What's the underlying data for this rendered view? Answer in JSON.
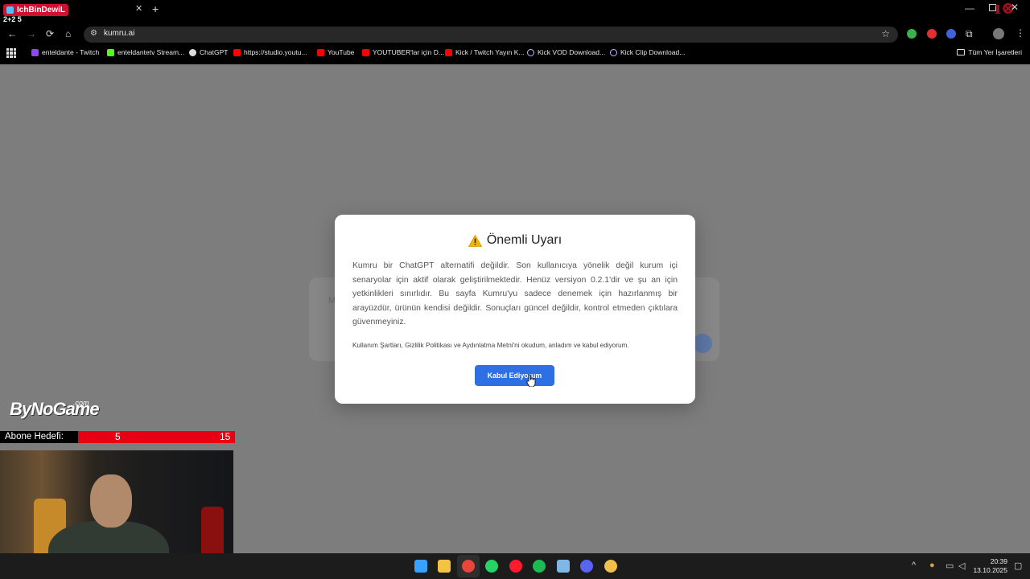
{
  "browser": {
    "tab_title": "IchBinDewiL",
    "overlay_text": "2+2 5",
    "url": "kumru.ai",
    "bookmarks": [
      {
        "label": "enteldante - Twitch",
        "icon": "twitch-icon",
        "color": "#9146ff"
      },
      {
        "label": "enteldantetv Stream...",
        "icon": "kick-icon",
        "color": "#53fc18"
      },
      {
        "label": "ChatGPT",
        "icon": "chatgpt-icon",
        "color": "#dddddd"
      },
      {
        "label": "https://studio.youtu...",
        "icon": "youtube-icon",
        "color": "#ff0000"
      },
      {
        "label": "YouTube",
        "icon": "youtube-icon",
        "color": "#ff0000"
      },
      {
        "label": "YOUTUBER'lar için D...",
        "icon": "youtube-icon",
        "color": "#ff0000"
      },
      {
        "label": "Kick / Twitch Yayın K...",
        "icon": "youtube-icon",
        "color": "#ff0000"
      },
      {
        "label": "Kick VOD Download...",
        "icon": "link-icon",
        "color": "#c9b6ff"
      },
      {
        "label": "Kick Clip Download...",
        "icon": "link-icon",
        "color": "#c9b6ff"
      }
    ],
    "all_bookmarks_label": "Tüm Yer İşaretleri"
  },
  "modal": {
    "title": "Önemli Uyarı",
    "body": "Kumru bir ChatGPT alternatifi değildir. Son kullanıcıya yönelik değil kurum içi senaryolar için aktif olarak geliştirilmektedir. Henüz versiyon 0.2.1'dir ve şu an için yetkinlikleri sınırlıdır. Bu sayfa Kumru'yu sadece denemek için hazırlanmış bir arayüzdür, ürünün kendisi değildir. Sonuçları güncel değildir, kontrol etmeden çıktılara güvenmeyiniz.",
    "terms": "Kullanım Şartları, Gizlilik Politikası ve Aydınlatma Metni'ni okudum, anladım ve kabul ediyorum.",
    "accept_label": "Kabul Ediyorum"
  },
  "background_page": {
    "placeholder": "M"
  },
  "stream_overlay": {
    "logo": "ByNoGame",
    "logo_suffix": ".com",
    "goal_label": "Abone Hedefi:",
    "goal_current": "5",
    "goal_target": "15"
  },
  "taskbar": {
    "time": "20:39",
    "date": "13.10.2025",
    "apps": [
      {
        "icon": "windows-start-icon",
        "color": "#3aa0ff"
      },
      {
        "icon": "file-explorer-icon",
        "color": "#f5c242"
      },
      {
        "icon": "chrome-icon",
        "color": "#e8453c"
      },
      {
        "icon": "whatsapp-icon",
        "color": "#25d366"
      },
      {
        "icon": "opera-icon",
        "color": "#ff1b2d"
      },
      {
        "icon": "spotify-icon",
        "color": "#1db954"
      },
      {
        "icon": "network-app-icon",
        "color": "#7fb8e6"
      },
      {
        "icon": "discord-icon",
        "color": "#5865f2"
      },
      {
        "icon": "game-app-icon",
        "color": "#f0c04a"
      }
    ]
  }
}
